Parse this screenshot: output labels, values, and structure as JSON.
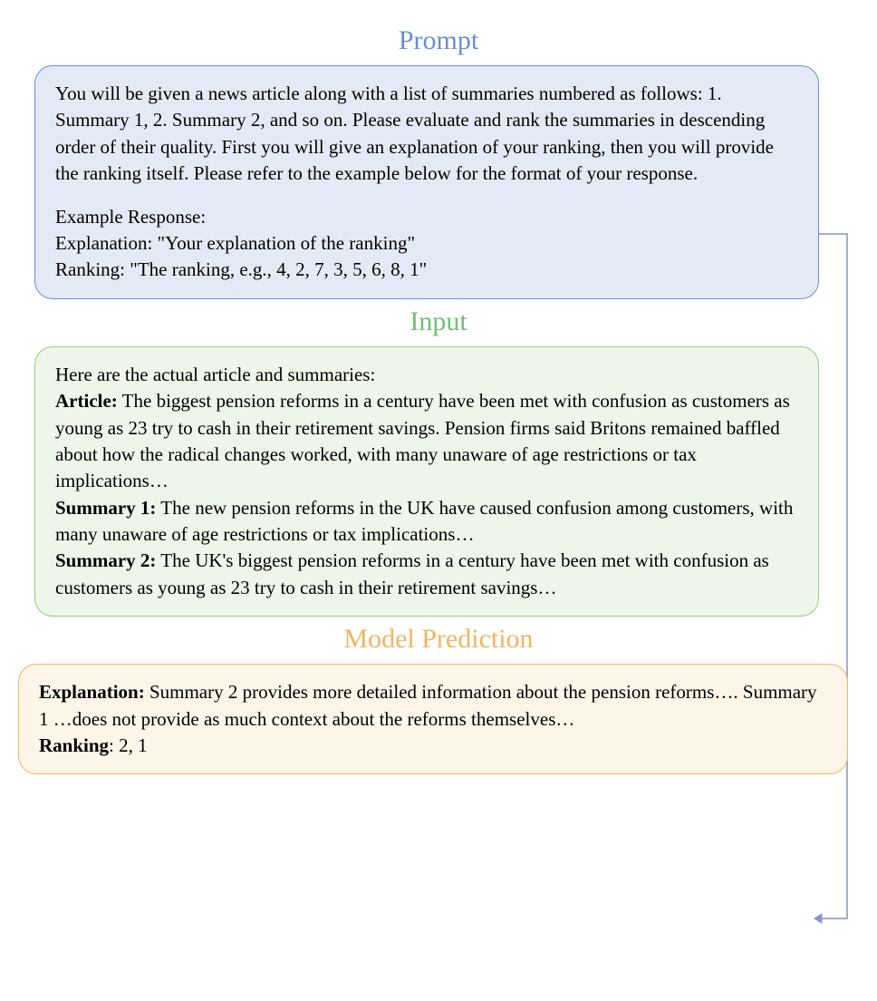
{
  "titles": {
    "prompt": "Prompt",
    "input": "Input",
    "output": "Model Prediction"
  },
  "prompt": {
    "p1": "You will be given a news article along with a list of summaries numbered as follows: 1. Summary 1, 2. Summary 2, and so on. Please evaluate and rank the summaries in descending order of their quality. First you will give an explanation of your ranking, then you will provide the ranking itself. Please refer to the example below for the format of your response.",
    "p2a": "Example Response:",
    "p2b": "Explanation: \"Your explanation of the ranking\"",
    "p2c": "Ranking: \"The ranking, e.g., 4, 2, 7, 3, 5, 6, 8, 1\""
  },
  "input": {
    "intro": "Here are the actual article and summaries:",
    "article_label": "Article:",
    "article_text": " The biggest pension reforms in a century have been met with confusion as customers as young as 23 try to cash in their retirement savings. Pension firms said Britons remained baffled about how the radical changes worked, with many unaware of age restrictions or tax implications…",
    "s1_label": "Summary 1:",
    "s1_text": " The new pension reforms in the UK have caused confusion among customers, with many unaware of age restrictions or tax implications…",
    "s2_label": "Summary 2:",
    "s2_text": " The UK's biggest pension reforms in a century have been met with confusion as customers as young as 23 try to cash in their retirement savings…"
  },
  "output": {
    "exp_label": "Explanation:",
    "exp_text": " Summary 2 provides more detailed information about the pension reforms…. Summary 1 …does not provide as much context about the reforms themselves…",
    "rank_label": "Ranking",
    "rank_text": ": 2, 1"
  }
}
